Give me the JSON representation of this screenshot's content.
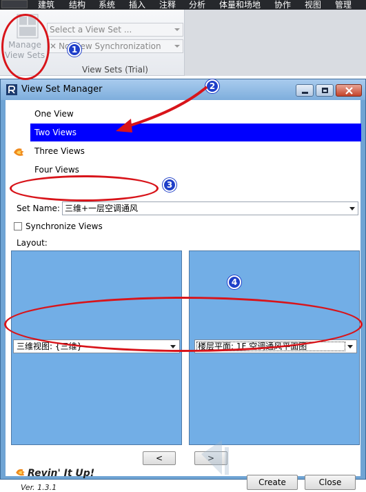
{
  "menubar": {
    "items": [
      "建筑",
      "结构",
      "系统",
      "插入",
      "注释",
      "分析",
      "体量和场地",
      "协作",
      "视图",
      "管理"
    ]
  },
  "ribbon": {
    "manage_label_line1": "Manage",
    "manage_label_line2": "View Sets",
    "select_view_set": "Select a View Set ...",
    "view_sync": "No View Synchronization",
    "panel_title": "View Sets (Trial)"
  },
  "dialog": {
    "title": "View Set Manager",
    "view_options": [
      "One View",
      "Two Views",
      "Three Views",
      "Four Views"
    ],
    "selected_view_option": "Two Views",
    "set_name_label": "Set Name:",
    "set_name_value": "三维+一层空调通风",
    "sync_label": "Synchronize Views",
    "sync_checked": false,
    "layout_label": "Layout:",
    "left_view": "三维视图: {三维}",
    "right_view": "楼层平面: 1F 空调通风平面图",
    "prev_label": "<",
    "next_label": ">",
    "create_label": "Create",
    "close_label": "Close",
    "brand": "Revin' It Up!",
    "version": "Ver. 1.3.1"
  },
  "annotations": {
    "markers": [
      "1",
      "2",
      "3",
      "4"
    ],
    "color": "#d8141a",
    "marker_color": "#1f3fc9"
  },
  "colors": {
    "selection": "#0000ff",
    "pane": "#72aee6",
    "titlebar": "#a9cbee"
  },
  "icons": [
    "manage-view-sets-icon",
    "revit-app-icon",
    "flame-icon",
    "close-x-icon"
  ]
}
